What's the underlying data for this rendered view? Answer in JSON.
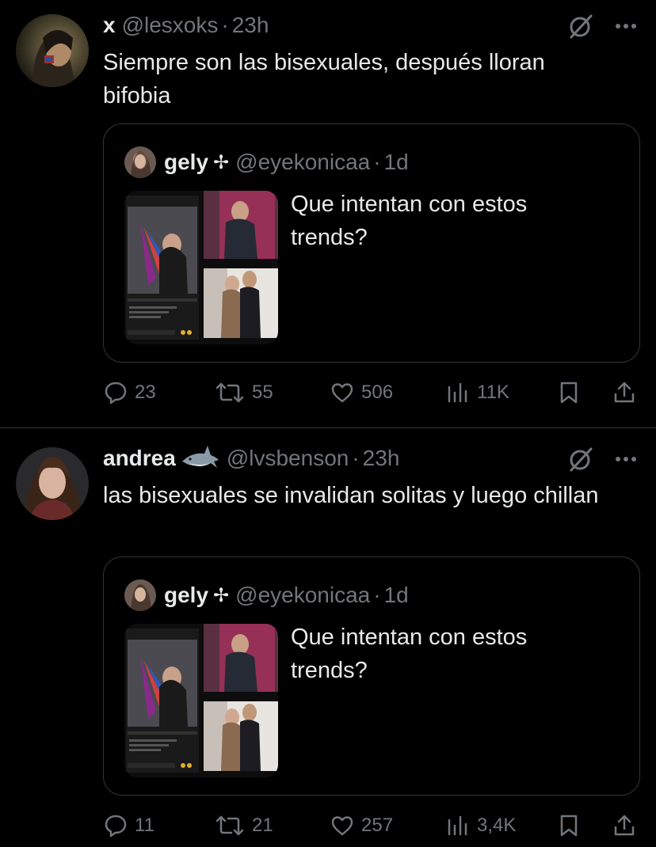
{
  "tweets": [
    {
      "name": "x",
      "handle": "@lesxoks",
      "time": "23h",
      "text": "Siempre son las bisexuales, después lloran bifobia",
      "quote": {
        "name": "gely",
        "cross": "✢",
        "handle": "@eyekonicaa",
        "time": "1d",
        "text": "Que intentan con estos trends?"
      },
      "stats": {
        "replies": "23",
        "reposts": "55",
        "likes": "506",
        "views": "11K"
      }
    },
    {
      "name": "andrea",
      "name_emoji": "shark-emoji",
      "handle": "@lvsbenson",
      "time": "23h",
      "text": "las bisexuales se invalidan solitas y luego chillan",
      "quote": {
        "name": "gely",
        "cross": "✢",
        "handle": "@eyekonicaa",
        "time": "1d",
        "text": "Que intentan con estos trends?"
      },
      "stats": {
        "replies": "11",
        "reposts": "21",
        "likes": "257",
        "views": "3,4K"
      }
    }
  ],
  "separator": "·",
  "colors": {
    "background": "#000000",
    "text": "#e7e9ea",
    "muted": "#71767b",
    "border": "#333639"
  }
}
